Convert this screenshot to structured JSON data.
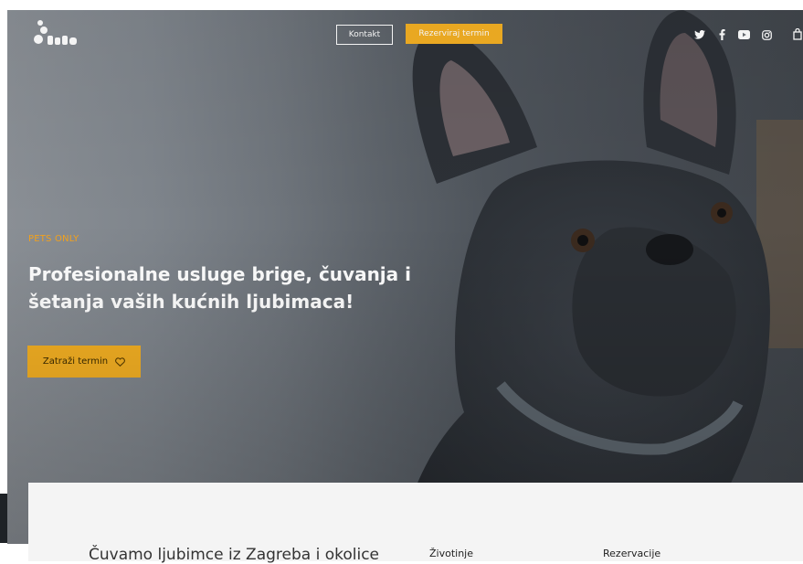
{
  "header": {
    "contact_label": "Kontakt",
    "book_label": "Rezerviraj termin",
    "social": [
      "twitter-icon",
      "facebook-icon",
      "youtube-icon",
      "instagram-icon",
      "bag-icon"
    ]
  },
  "hero": {
    "eyebrow": "PETS ONLY",
    "headline": "Profesionalne usluge brige, čuvanja i šetanja vaših kućnih ljubimaca!",
    "cta_label": "Zatraži termin"
  },
  "footer_preview": {
    "title": "Čuvamo ljubimce iz Zagreba i okolice",
    "col1": "Životinje",
    "col2": "Rezervacije"
  },
  "colors": {
    "accent": "#f4b023",
    "eyebrow": "#f4a21c"
  }
}
